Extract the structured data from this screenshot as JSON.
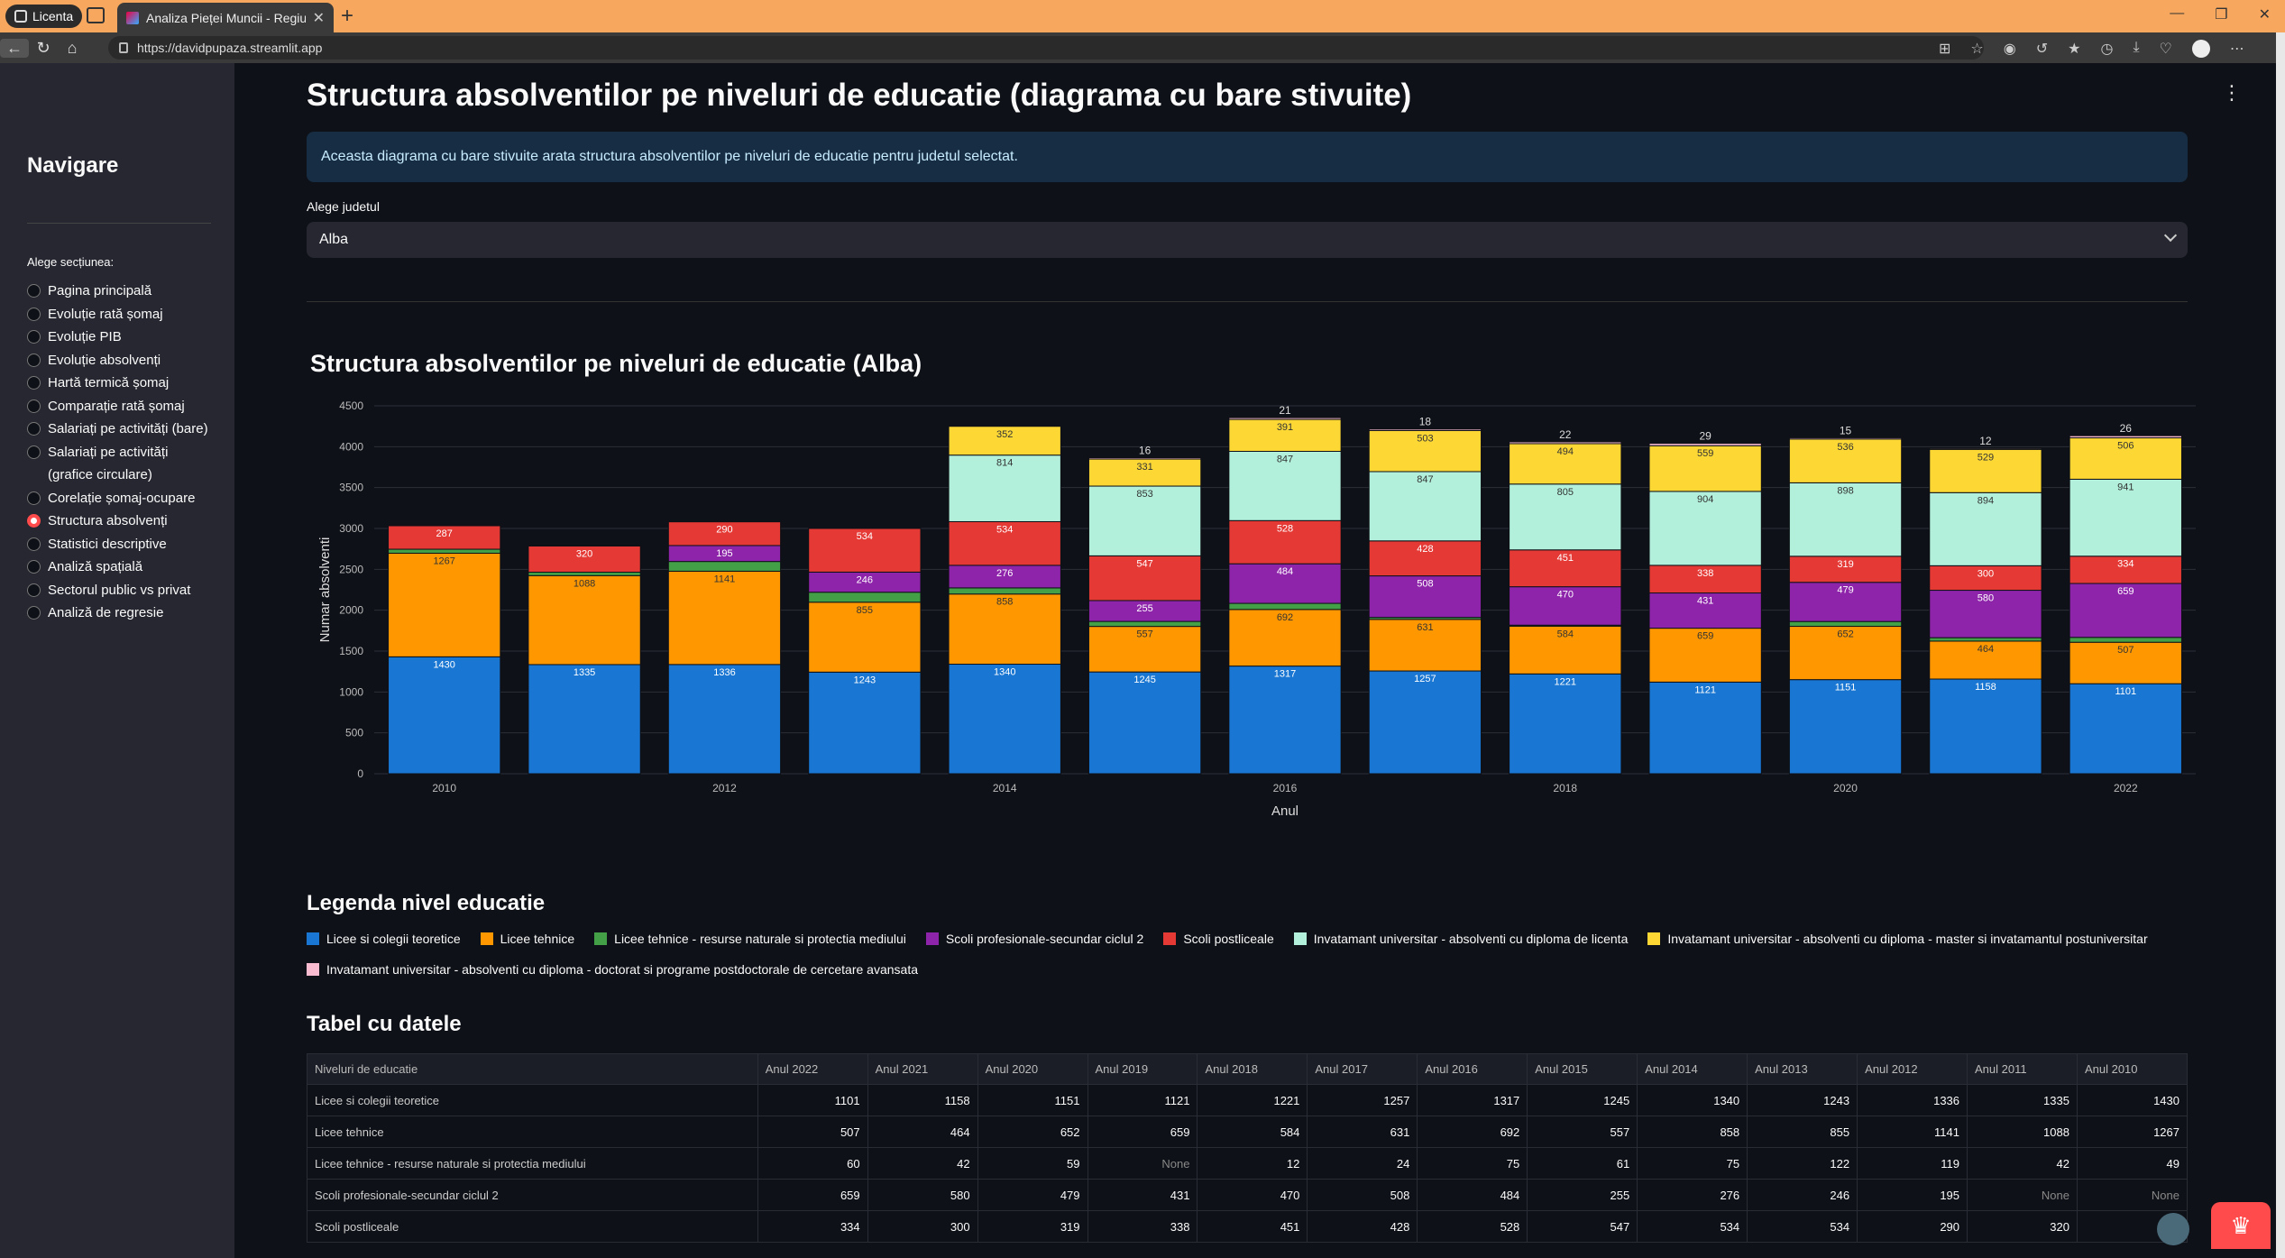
{
  "browser": {
    "profile_label": "Licenta",
    "tab_title": "Analiza Pieței Muncii - Regiunea C",
    "url": "https://davidpupaza.streamlit.app"
  },
  "sidebar": {
    "title": "Navigare",
    "radio_label": "Alege secțiunea:",
    "items": [
      {
        "label": "Pagina principală",
        "selected": false
      },
      {
        "label": "Evoluție rată șomaj",
        "selected": false
      },
      {
        "label": "Evoluție PIB",
        "selected": false
      },
      {
        "label": "Evoluție absolvenți",
        "selected": false
      },
      {
        "label": "Hartă termică șomaj",
        "selected": false
      },
      {
        "label": "Comparație rată șomaj",
        "selected": false
      },
      {
        "label": "Salariați pe activități (bare)",
        "selected": false
      },
      {
        "label": "Salariați pe activități (grafice circulare)",
        "selected": false
      },
      {
        "label": "Corelație șomaj-ocupare",
        "selected": false
      },
      {
        "label": "Structura absolvenți",
        "selected": true
      },
      {
        "label": "Statistici descriptive",
        "selected": false
      },
      {
        "label": "Analiză spațială",
        "selected": false
      },
      {
        "label": "Sectorul public vs privat",
        "selected": false
      },
      {
        "label": "Analiză de regresie",
        "selected": false
      }
    ]
  },
  "main": {
    "page_title": "Structura absolventilor pe niveluri de educatie (diagrama cu bare stivuite)",
    "info_text": "Aceasta diagrama cu bare stivuite arata structura absolventilor pe niveluri de educatie pentru judetul selectat.",
    "select_label": "Alege judetul",
    "select_value": "Alba",
    "chart_title": "Structura absolventilor pe niveluri de educatie (Alba)",
    "legend_title": "Legenda nivel educatie",
    "table_title": "Tabel cu datele"
  },
  "chart_data": {
    "type": "bar",
    "stacked": true,
    "xlabel": "Anul",
    "ylabel": "Numar absolventi",
    "ylim": [
      0,
      4500
    ],
    "yticks": [
      0,
      500,
      1000,
      1500,
      2000,
      2500,
      3000,
      3500,
      4000,
      4500
    ],
    "xtick_labels": [
      "2010",
      "2012",
      "2014",
      "2016",
      "2018",
      "2020",
      "2022"
    ],
    "grid": true,
    "categories": [
      2010,
      2011,
      2012,
      2013,
      2014,
      2015,
      2016,
      2017,
      2018,
      2019,
      2020,
      2021,
      2022
    ],
    "series": [
      {
        "name": "Licee si colegii teoretice",
        "color": "#1976d2",
        "values": [
          1430,
          1335,
          1336,
          1243,
          1340,
          1245,
          1317,
          1257,
          1221,
          1121,
          1151,
          1158,
          1101
        ]
      },
      {
        "name": "Licee tehnice",
        "color": "#ff9800",
        "values": [
          1267,
          1088,
          1141,
          855,
          858,
          557,
          692,
          631,
          584,
          659,
          652,
          464,
          507
        ]
      },
      {
        "name": "Licee tehnice - resurse naturale si protectia mediului",
        "color": "#43a047",
        "values": [
          49,
          42,
          119,
          122,
          75,
          61,
          75,
          24,
          12,
          null,
          59,
          42,
          60
        ]
      },
      {
        "name": "Scoli profesionale-secundar ciclul 2",
        "color": "#8e24aa",
        "values": [
          null,
          null,
          195,
          246,
          276,
          255,
          484,
          508,
          470,
          431,
          479,
          580,
          659
        ]
      },
      {
        "name": "Scoli postliceale",
        "color": "#e53935",
        "values": [
          287,
          320,
          290,
          534,
          534,
          547,
          528,
          428,
          451,
          338,
          319,
          300,
          334
        ]
      },
      {
        "name": "Invatamant universitar - absolventi cu diploma de licenta",
        "color": "#b2f0dc",
        "values": [
          null,
          null,
          null,
          null,
          814,
          853,
          847,
          847,
          805,
          904,
          898,
          894,
          941
        ]
      },
      {
        "name": "Invatamant universitar - absolventi cu diploma - master si invatamantul postuniversitar",
        "color": "#fdd835",
        "values": [
          null,
          null,
          null,
          null,
          352,
          331,
          391,
          503,
          494,
          559,
          536,
          529,
          506
        ]
      },
      {
        "name": "Invatamant universitar - absolventi cu diploma - doctorat si programe postdoctorale de cercetare avansata",
        "color": "#f8bbd0",
        "values": [
          null,
          null,
          null,
          null,
          null,
          16,
          21,
          18,
          22,
          29,
          15,
          12,
          26
        ]
      }
    ]
  },
  "table": {
    "headers": [
      "Niveluri de educatie",
      "Anul 2022",
      "Anul 2021",
      "Anul 2020",
      "Anul 2019",
      "Anul 2018",
      "Anul 2017",
      "Anul 2016",
      "Anul 2015",
      "Anul 2014",
      "Anul 2013",
      "Anul 2012",
      "Anul 2011",
      "Anul 2010"
    ],
    "rows": [
      [
        "Licee si colegii teoretice",
        "1101",
        "1158",
        "1151",
        "1121",
        "1221",
        "1257",
        "1317",
        "1245",
        "1340",
        "1243",
        "1336",
        "1335",
        "1430"
      ],
      [
        "Licee tehnice",
        "507",
        "464",
        "652",
        "659",
        "584",
        "631",
        "692",
        "557",
        "858",
        "855",
        "1141",
        "1088",
        "1267"
      ],
      [
        "Licee tehnice - resurse naturale si protectia mediului",
        "60",
        "42",
        "59",
        "None",
        "12",
        "24",
        "75",
        "61",
        "75",
        "122",
        "119",
        "42",
        "49"
      ],
      [
        "Scoli profesionale-secundar ciclul 2",
        "659",
        "580",
        "479",
        "431",
        "470",
        "508",
        "484",
        "255",
        "276",
        "246",
        "195",
        "None",
        "None"
      ],
      [
        "Scoli postliceale",
        "334",
        "300",
        "319",
        "338",
        "451",
        "428",
        "528",
        "547",
        "534",
        "534",
        "290",
        "320",
        "287"
      ]
    ]
  }
}
